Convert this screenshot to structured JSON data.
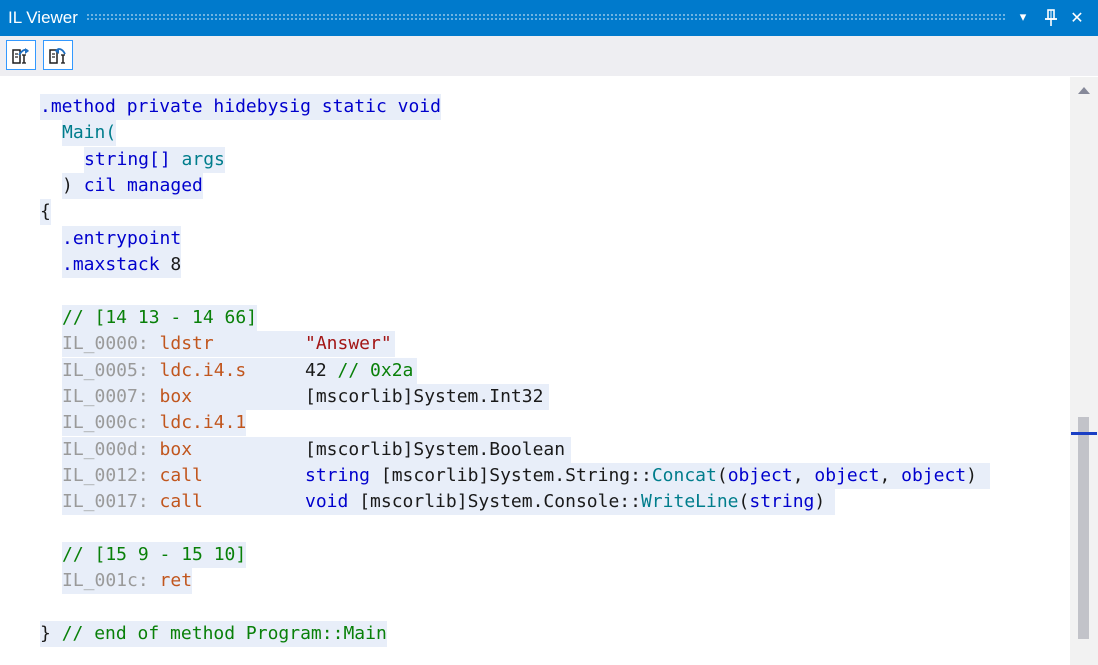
{
  "window": {
    "title": "IL Viewer",
    "dropdown_glyph": "▾",
    "pin_glyph": "⊥",
    "close_glyph": "✕"
  },
  "toolbar": {
    "buttons": [
      {
        "icon": "navigate-to-source-icon"
      },
      {
        "icon": "navigate-from-source-icon"
      }
    ]
  },
  "code": {
    "method_decl": ".method private hidebysig static void",
    "method_name": "Main(",
    "param_type": "string[]",
    "param_name": "args",
    "cil_close": ")",
    "cil_managed": "cil managed",
    "open_brace": "{",
    "entrypoint": ".entrypoint",
    "maxstack_kw": ".maxstack",
    "maxstack_val": "8",
    "seq1": "// [14 13 - 14 66]",
    "instructions": [
      {
        "offset": "IL_0000:",
        "opcode": "ldstr",
        "operand": "\"Answer\""
      },
      {
        "offset": "IL_0005:",
        "opcode": "ldc.i4.s",
        "operand": "42",
        "comment": "// 0x2a"
      },
      {
        "offset": "IL_0007:",
        "opcode": "box",
        "operand_prefix": "[mscorlib]System.Int32"
      },
      {
        "offset": "IL_000c:",
        "opcode": "ldc.i4.1"
      },
      {
        "offset": "IL_000d:",
        "opcode": "box",
        "operand_prefix": "[mscorlib]System.Boolean"
      },
      {
        "offset": "IL_0012:",
        "opcode": "call",
        "ret_type": "string",
        "operand_prefix": "[mscorlib]System.String::",
        "member": "Concat",
        "args_open": "(",
        "arg1": "object",
        "sep1": ", ",
        "arg2": "object",
        "sep2": ", ",
        "arg3": "object",
        "args_close": ")"
      },
      {
        "offset": "IL_0017:",
        "opcode": "call",
        "ret_type": "void",
        "operand_prefix": "[mscorlib]System.Console::",
        "member": "WriteLine",
        "args_open": "(",
        "arg1": "string",
        "args_close": ")"
      }
    ],
    "seq2": "// [15 9 - 15 10]",
    "ret_offset": "IL_001c:",
    "ret_opcode": "ret",
    "close_brace": "}",
    "end_comment": "// end of method Program::Main"
  },
  "colors": {
    "titlebar": "#007acc",
    "line_highlight": "#e8eef9",
    "keyword": "#0000cd",
    "identifier": "#007d8c",
    "comment": "#098009",
    "offset": "#9a9a9a",
    "opcode": "#c1561e",
    "string": "#a31515"
  }
}
